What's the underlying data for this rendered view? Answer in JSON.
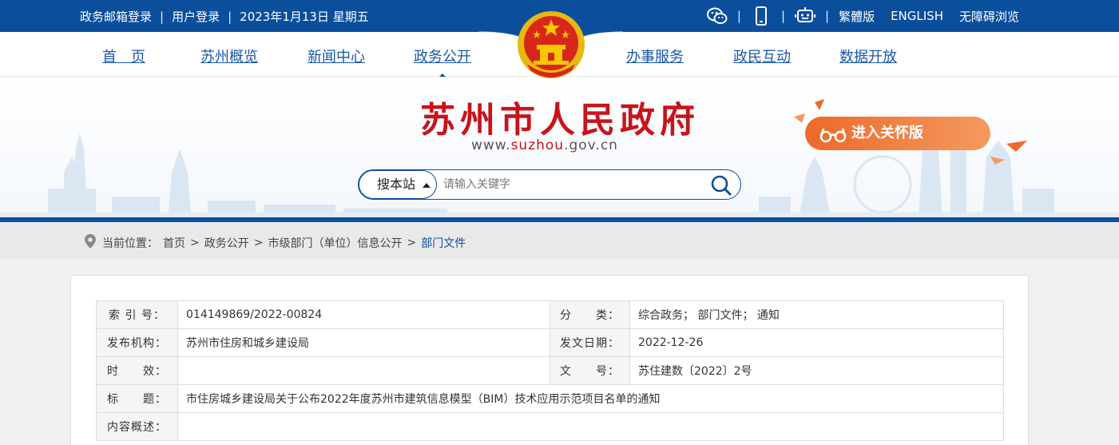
{
  "topbar": {
    "mail_login": "政务邮箱登录",
    "user_login": "用户登录",
    "date": "2023年1月13日 星期五",
    "traditional": "繁體版",
    "english": "ENGLISH",
    "accessible": "无障碍浏览",
    "icons": [
      "wechat-icon",
      "mobile-icon",
      "robot-icon"
    ]
  },
  "nav": {
    "items": [
      {
        "label": "首　页"
      },
      {
        "label": "苏州概览"
      },
      {
        "label": "新闻中心"
      },
      {
        "label": "政务公开"
      },
      {
        "label": "办事服务"
      },
      {
        "label": "政民互动"
      },
      {
        "label": "数据开放"
      }
    ],
    "active": "政务公开"
  },
  "banner": {
    "title": "苏州市人民政府",
    "url_prefix": "www.",
    "url_accent": "suzhou",
    "url_suffix": ".gov.cn",
    "care_label": "进入关怀版",
    "colors": {
      "brand": "#0b4e9c",
      "title": "#c8131b",
      "care": "#ec6a2a"
    }
  },
  "search": {
    "scope": "搜本站",
    "placeholder": "请输入关键字"
  },
  "breadcrumb": {
    "prefix": "当前位置：",
    "items": [
      "首页",
      "政务公开",
      "市级部门（单位）信息公开"
    ],
    "current": "部门文件"
  },
  "info": {
    "index_label": "索 引 号：",
    "index_value": "014149869/2022-00824",
    "category_label": "分　　类：",
    "category_value": "综合政务； 部门文件； 通知",
    "issuer_label": "发布机构：",
    "issuer_value": "苏州市住房和城乡建设局",
    "date_label": "发文日期：",
    "date_value": "2022-12-26",
    "validity_label": "时　　效：",
    "validity_value": "",
    "docno_label": "文　　号：",
    "docno_value": "苏住建数〔2022〕2号",
    "title_label": "标　　题：",
    "title_value": "市住房城乡建设局关于公布2022年度苏州市建筑信息模型（BIM）技术应用示范项目名单的通知",
    "summary_label": "内容概述：",
    "summary_value": ""
  }
}
